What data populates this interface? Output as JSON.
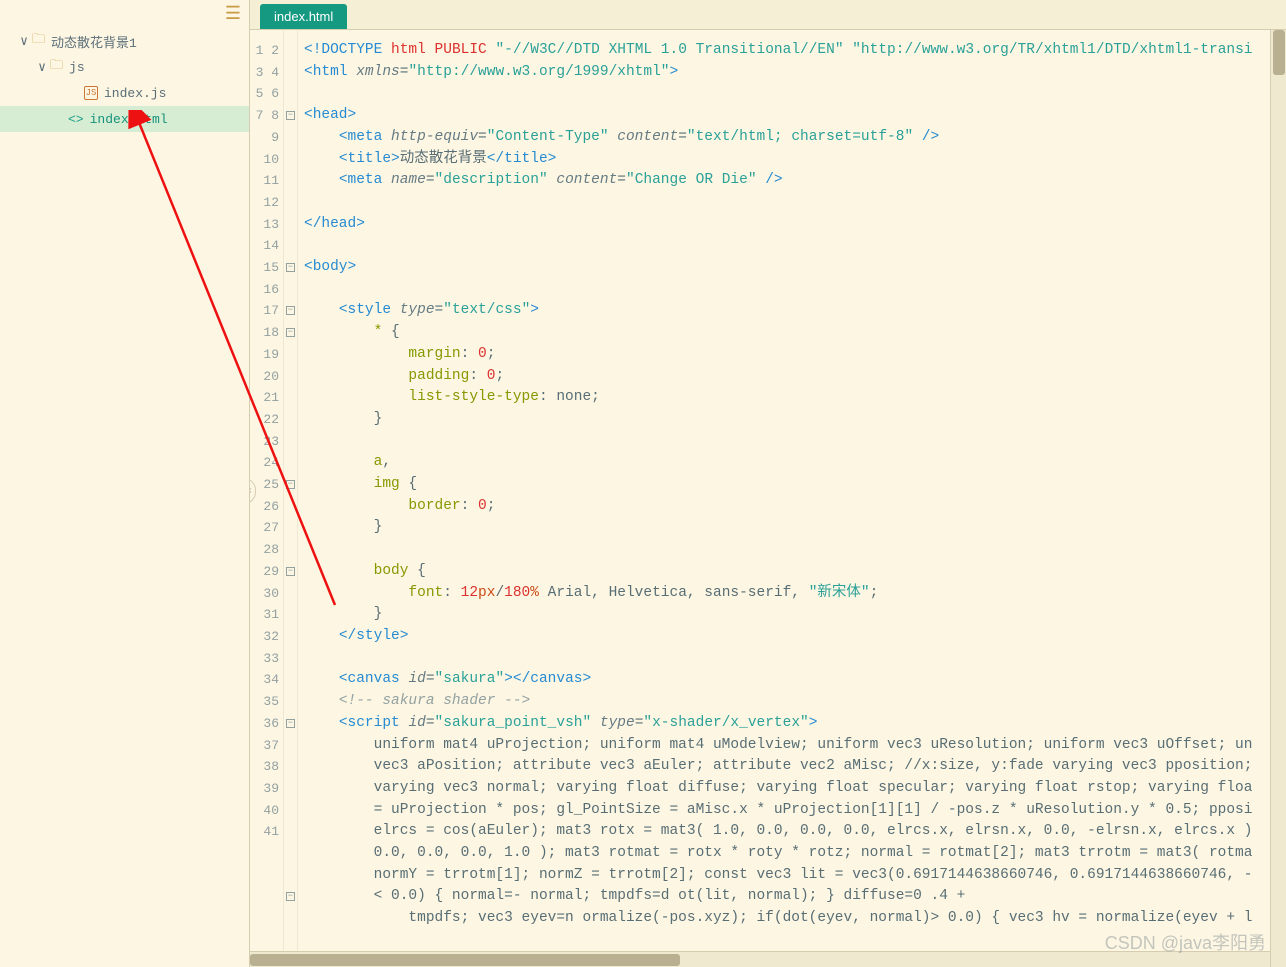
{
  "sidebar": {
    "items": [
      {
        "label": "动态散花背景1",
        "indent": 18,
        "kind": "folder",
        "arrow": "∨",
        "selected": false
      },
      {
        "label": "js",
        "indent": 36,
        "kind": "folder",
        "arrow": "∨",
        "selected": false
      },
      {
        "label": "index.js",
        "indent": 70,
        "kind": "js",
        "arrow": "",
        "selected": false
      },
      {
        "label": "index.html",
        "indent": 54,
        "kind": "html",
        "arrow": "",
        "selected": true
      }
    ]
  },
  "tab": {
    "label": "index.html"
  },
  "gutter": {
    "start": 1,
    "end": 41
  },
  "fold_markers": {
    "4": "⊟",
    "11": "⊟",
    "13": "⊟",
    "14": "⊟",
    "21": "⊟",
    "25": "⊟",
    "32": "⊟",
    "40": "⊟"
  },
  "watermark": "CSDN @java李阳勇",
  "code_lines": [
    "<span class='tag'>&lt;!DOCTYPE</span> <span class='red'>html</span> <span class='red'>PUBLIC</span> <span class='teal'>\"-//W3C//DTD XHTML 1.0 Transitional//EN\"</span> <span class='teal'>\"http://www.w3.org/TR/xhtml1/DTD/xhtml1-transi</span>",
    "<span class='tag'>&lt;html</span> <span class='attr'>xmlns</span>=<span class='teal'>\"http://www.w3.org/1999/xhtml\"</span><span class='tag'>&gt;</span>",
    "",
    "<span class='tag'>&lt;head&gt;</span>",
    "    <span class='tag'>&lt;meta</span> <span class='attr'>http-equiv</span>=<span class='teal'>\"Content-Type\"</span> <span class='attr'>content</span>=<span class='teal'>\"text/html; charset=utf-8\"</span> <span class='tag'>/&gt;</span>",
    "    <span class='tag'>&lt;title&gt;</span>动态散花背景<span class='tag'>&lt;/title&gt;</span>",
    "    <span class='tag'>&lt;meta</span> <span class='attr'>name</span>=<span class='teal'>\"description\"</span> <span class='attr'>content</span>=<span class='teal'>\"Change OR Die\"</span> <span class='tag'>/&gt;</span>",
    "",
    "<span class='tag'>&lt;/head&gt;</span>",
    "",
    "<span class='tag'>&lt;body&gt;</span>",
    "",
    "    <span class='tag'>&lt;style</span> <span class='attr'>type</span>=<span class='teal'>\"text/css\"</span><span class='tag'>&gt;</span>",
    "        <span class='name-c'>*</span> {",
    "            <span class='name-c'>margin</span>: <span class='red'>0</span>;",
    "            <span class='name-c'>padding</span>: <span class='red'>0</span>;",
    "            <span class='name-c'>list-style-type</span>: none;",
    "        }",
    "",
    "        <span class='name-c'>a</span>,",
    "        <span class='name-c'>img</span> {",
    "            <span class='name-c'>border</span>: <span class='red'>0</span>;",
    "        }",
    "",
    "        <span class='name-c'>body</span> {",
    "            <span class='name-c'>font</span>: <span class='red'>12</span><span class='orange'>px</span>/<span class='red'>180</span><span class='orange'>%</span> Arial, Helvetica, sans-serif, <span class='teal'>\"新宋体\"</span>;",
    "        }",
    "    <span class='tag'>&lt;/style&gt;</span>",
    "",
    "    <span class='tag'>&lt;canvas</span> <span class='attr'>id</span>=<span class='teal'>\"sakura\"</span><span class='tag'>&gt;&lt;/canvas&gt;</span>",
    "    <span class='comment'>&lt;!-- sakura shader --&gt;</span>",
    "    <span class='tag'>&lt;script</span> <span class='attr'>id</span>=<span class='teal'>\"sakura_point_vsh\"</span> <span class='attr'>type</span>=<span class='teal'>\"x-shader/x_vertex\"</span><span class='tag'>&gt;</span>",
    "        uniform mat4 uProjection; uniform mat4 uModelview; uniform vec3 uResolution; uniform vec3 uOffset; un",
    "        vec3 aPosition; attribute vec3 aEuler; attribute vec2 aMisc; //x:size, y:fade varying vec3 pposition;",
    "        varying vec3 normal; varying float diffuse; varying float specular; varying float rstop; varying floa",
    "        = uProjection * pos; gl_PointSize = aMisc.x * uProjection[1][1] / -pos.z * uResolution.y * 0.5; pposi",
    "        elrcs = cos(aEuler); mat3 rotx = mat3( 1.0, 0.0, 0.0, 0.0, elrcs.x, elrsn.x, 0.0, -elrsn.x, elrcs.x )",
    "        0.0, 0.0, 0.0, 1.0 ); mat3 rotmat = rotx * roty * rotz; normal = rotmat[2]; mat3 trrotm = mat3( rotma",
    "        normY = trrotm[1]; normZ = trrotm[2]; const vec3 lit = vec3(0.6917144638660746, 0.6917144638660746, -",
    "        &lt; 0.0) { normal=- normal; tmpdfs=d ot(lit, normal); } diffuse=0 .4 +",
    "            tmpdfs; vec3 eyev=n ormalize(-pos.xyz); if(dot(eyev, normal)&gt; 0.0) { vec3 hv = normalize(eyev + l"
  ]
}
